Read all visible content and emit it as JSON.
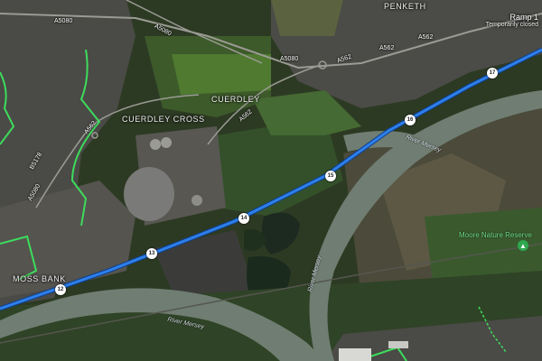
{
  "places": {
    "penketh": "PENKETH",
    "cuerdley": "CUERDLEY",
    "cuerdley_cross": "CUERDLEY CROSS",
    "moss_bank": "MOSS BANK"
  },
  "roads": {
    "a5080": "A5080",
    "a5080_2": "A5080",
    "a562_1": "A562",
    "a562_2": "A562",
    "a562_3": "A562",
    "b5178": "B5178",
    "a5080_w": "A5080"
  },
  "rivers": {
    "mersey_1": "River Mersey",
    "mersey_2": "River Mersey",
    "mersey_3": "River Mersey"
  },
  "poi": {
    "moore": "Moore Nature Reserve",
    "moore_icon": "tree-marker-icon"
  },
  "notice": {
    "title": "Ramp 1",
    "subtitle": "Temporarily closed"
  },
  "route_markers": [
    "12",
    "13",
    "14",
    "15",
    "16",
    "17"
  ],
  "colors": {
    "route": "#2f7fe8",
    "route_border": "#0b3f8f",
    "cycle_path": "#3ddc5c",
    "river": "#6f7d72"
  }
}
